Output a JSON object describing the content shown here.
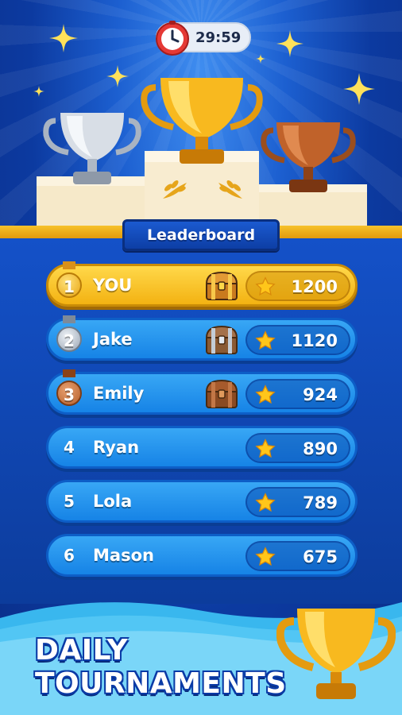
{
  "timer": {
    "value": "29:59"
  },
  "leaderboard": {
    "title": "Leaderboard",
    "rows": [
      {
        "rank": "1",
        "name": "YOU",
        "score": "1200",
        "medal": "gold",
        "chest": "gold"
      },
      {
        "rank": "2",
        "name": "Jake",
        "score": "1120",
        "medal": "silver",
        "chest": "silver"
      },
      {
        "rank": "3",
        "name": "Emily",
        "score": "924",
        "medal": "bronze",
        "chest": "bronze"
      },
      {
        "rank": "4",
        "name": "Ryan",
        "score": "890",
        "medal": "none",
        "chest": "none"
      },
      {
        "rank": "5",
        "name": "Lola",
        "score": "789",
        "medal": "none",
        "chest": "none"
      },
      {
        "rank": "6",
        "name": "Mason",
        "score": "675",
        "medal": "none",
        "chest": "none"
      }
    ]
  },
  "promo": {
    "line1": "DAILY",
    "line2": "TOURNAMENTS"
  },
  "colors": {
    "gold": "#f3b212",
    "blue_row": "#1683e6",
    "background": "#0c3aa0"
  }
}
